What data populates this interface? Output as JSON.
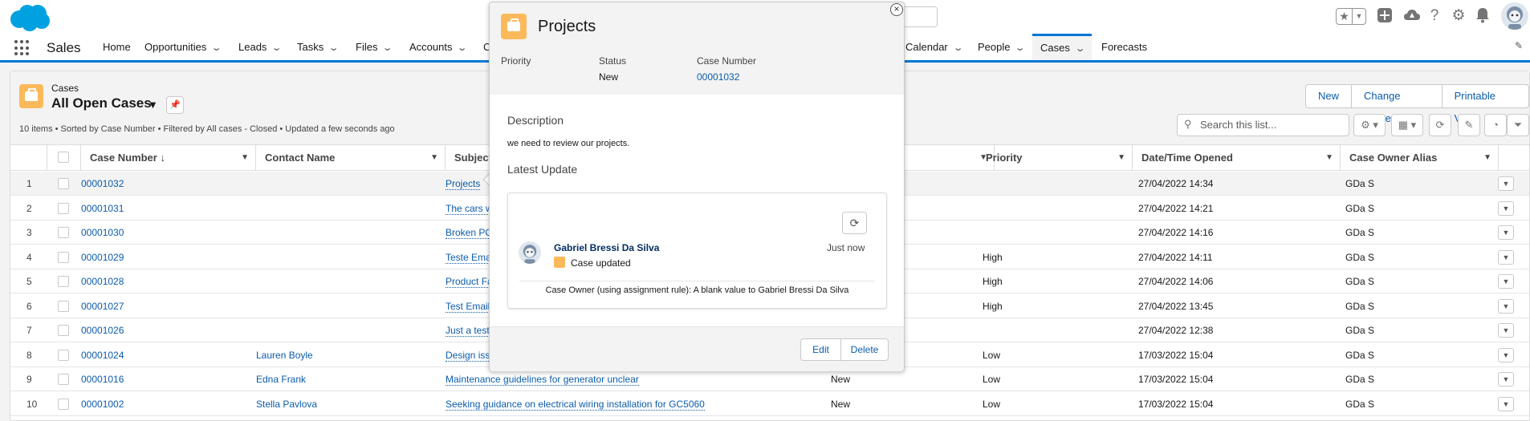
{
  "brand": {
    "accent": "#0176d3",
    "case_icon_color": "#fcb95b",
    "cloud_color": "#00a1e0"
  },
  "global_header": {
    "icons": [
      "salesforce-logo",
      "favorites-star-icon",
      "favorites-chevron-icon",
      "add-icon",
      "trailhead-icon",
      "help-icon",
      "settings-gear-icon",
      "notifications-bell-icon",
      "user-avatar"
    ]
  },
  "nav": {
    "app_name": "Sales",
    "items": [
      {
        "label": "Home",
        "chevron": false
      },
      {
        "label": "Opportunities",
        "chevron": true
      },
      {
        "label": "Leads",
        "chevron": true
      },
      {
        "label": "Tasks",
        "chevron": true
      },
      {
        "label": "Files",
        "chevron": true
      },
      {
        "label": "Accounts",
        "chevron": true
      },
      {
        "label": "C",
        "chevron": false
      },
      {
        "label": "Calendar",
        "chevron": true
      },
      {
        "label": "People",
        "chevron": true
      },
      {
        "label": "Cases",
        "chevron": true,
        "active": true
      },
      {
        "label": "Forecasts",
        "chevron": false
      }
    ]
  },
  "list_view": {
    "object_label": "Cases",
    "view_name": "All Open Cases",
    "meta": "10 items • Sorted by Case Number • Filtered by All cases - Closed • Updated a few seconds ago",
    "actions": [
      "New",
      "Change Owner",
      "Printable View"
    ],
    "search_placeholder": "Search this list...",
    "columns": {
      "case_number": "Case Number",
      "sort_arrow": "↓",
      "contact_name": "Contact Name",
      "subject": "Subject",
      "priority": "Priority",
      "date_opened": "Date/Time Opened",
      "owner_alias": "Case Owner Alias"
    },
    "rows": [
      {
        "num": "1",
        "case": "00001032",
        "contact": "",
        "subject": "Projects",
        "status": "",
        "priority": "",
        "opened": "27/04/2022 14:34",
        "owner": "GDa S"
      },
      {
        "num": "2",
        "case": "00001031",
        "contact": "",
        "subject": "The cars w",
        "status": "",
        "priority": "",
        "opened": "27/04/2022 14:21",
        "owner": "GDa S"
      },
      {
        "num": "3",
        "case": "00001030",
        "contact": "",
        "subject": "Broken PC",
        "status": "",
        "priority": "",
        "opened": "27/04/2022 14:16",
        "owner": "GDa S"
      },
      {
        "num": "4",
        "case": "00001029",
        "contact": "",
        "subject": "Teste Emai",
        "status": "",
        "priority": "High",
        "opened": "27/04/2022 14:11",
        "owner": "GDa S"
      },
      {
        "num": "5",
        "case": "00001028",
        "contact": "",
        "subject": "Product Fa",
        "status": "",
        "priority": "High",
        "opened": "27/04/2022 14:06",
        "owner": "GDa S"
      },
      {
        "num": "6",
        "case": "00001027",
        "contact": "",
        "subject": "Test EmailT",
        "status": "",
        "priority": "High",
        "opened": "27/04/2022 13:45",
        "owner": "GDa S"
      },
      {
        "num": "7",
        "case": "00001026",
        "contact": "",
        "subject": "Just a test",
        "status": "",
        "priority": "",
        "opened": "27/04/2022 12:38",
        "owner": "GDa S"
      },
      {
        "num": "8",
        "case": "00001024",
        "contact": "Lauren Boyle",
        "subject": "Design issi",
        "status": "",
        "priority": "Low",
        "opened": "17/03/2022 15:04",
        "owner": "GDa S"
      },
      {
        "num": "9",
        "case": "00001016",
        "contact": "Edna Frank",
        "subject": "Maintenance guidelines for generator unclear",
        "status": "New",
        "priority": "Low",
        "opened": "17/03/2022 15:04",
        "owner": "GDa S"
      },
      {
        "num": "10",
        "case": "00001002",
        "contact": "Stella Pavlova",
        "subject": "Seeking guidance on electrical wiring installation for GC5060",
        "status": "New",
        "priority": "Low",
        "opened": "17/03/2022 15:04",
        "owner": "GDa S"
      }
    ]
  },
  "hover_card": {
    "title": "Projects",
    "fields": {
      "priority_label": "Priority",
      "priority_value": "",
      "status_label": "Status",
      "status_value": "New",
      "case_number_label": "Case Number",
      "case_number_value": "00001032"
    },
    "description_label": "Description",
    "description": "we need to review our projects.",
    "latest_update_label": "Latest Update",
    "feed": {
      "actor": "Gabriel Bressi Da Silva",
      "action": "Case updated",
      "time": "Just now",
      "change": "Case Owner (using assignment rule): A blank value to Gabriel Bressi Da Silva"
    },
    "edit_label": "Edit",
    "delete_label": "Delete",
    "close_glyph": "×"
  }
}
